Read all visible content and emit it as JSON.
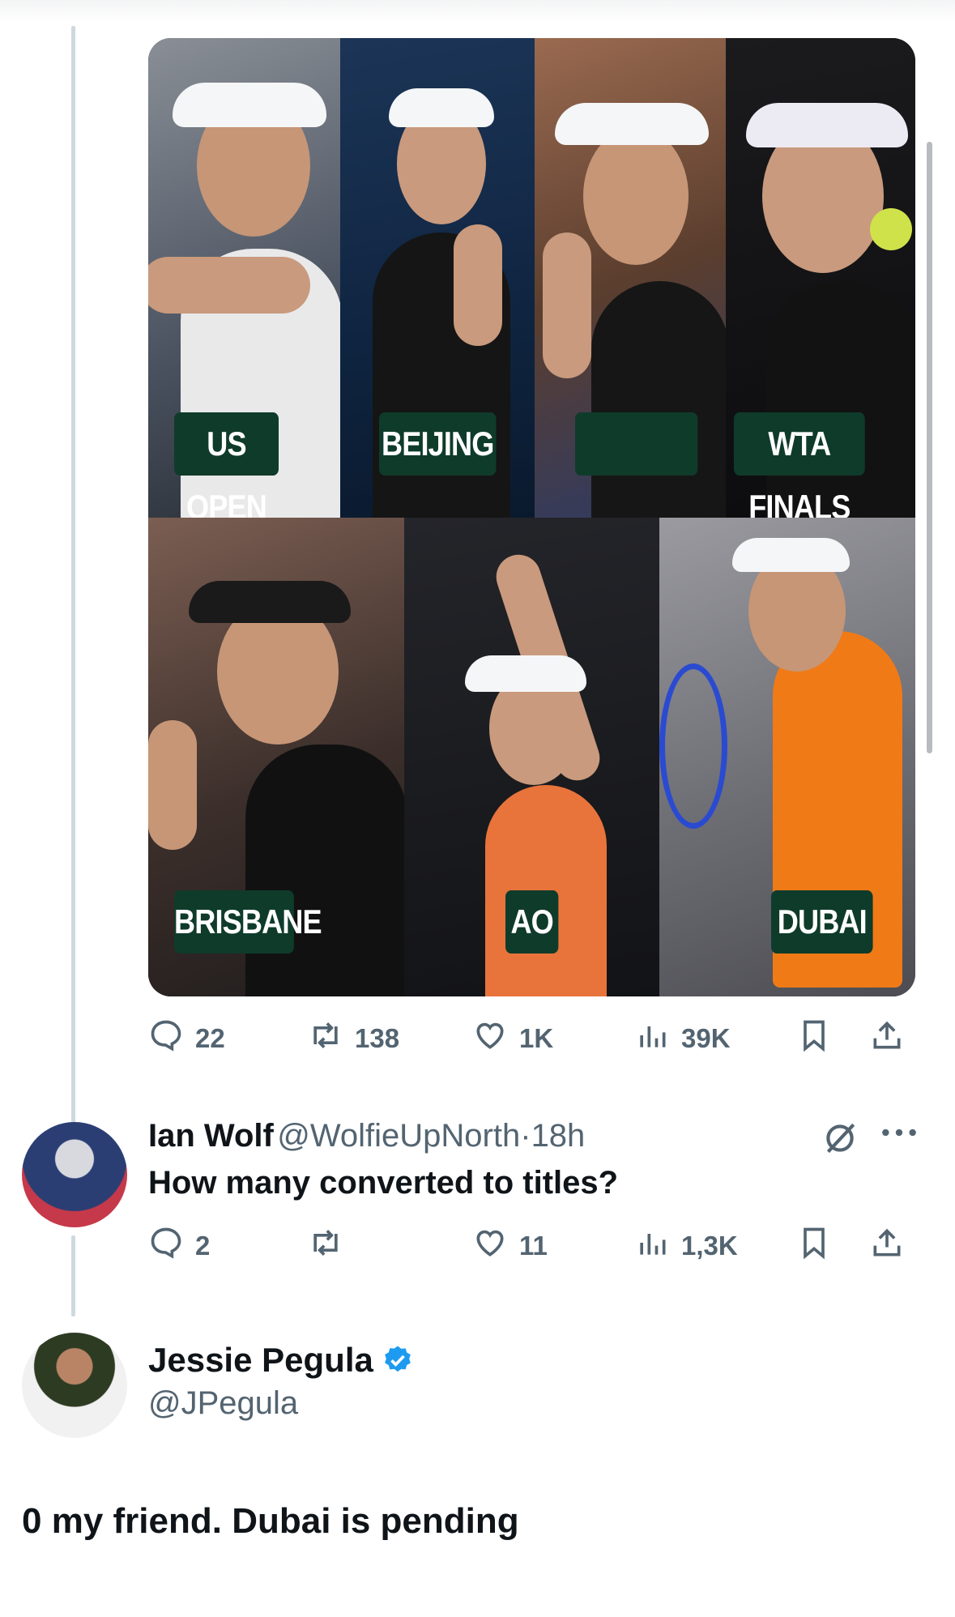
{
  "original_tweet": {
    "media_labels": {
      "us_open": "US OPEN",
      "beijing": "BEIJING",
      "blank": "",
      "wta_finals": "WTA FINALS",
      "brisbane": "BRISBANE",
      "ao": "AO",
      "dubai": "DUBAI"
    },
    "stats": {
      "replies": "22",
      "reposts": "138",
      "likes": "1K",
      "views": "39K"
    }
  },
  "reply": {
    "name": "Ian Wolf",
    "handle": "@WolfieUpNorth",
    "separator": "·",
    "time": "18h",
    "text": "How many converted to titles?",
    "stats": {
      "replies": "2",
      "reposts": "",
      "likes": "11",
      "views": "1,3K"
    }
  },
  "focused_reply": {
    "name": "Jessie Pegula",
    "handle": "@JPegula",
    "verified": true,
    "text": "0 my friend. Dubai is pending"
  },
  "icons": [
    "comment-icon",
    "repost-icon",
    "heart-icon",
    "views-icon",
    "bookmark-icon",
    "share-icon",
    "grok-icon",
    "more-icon",
    "verified-icon"
  ],
  "colors": {
    "label_bg": "#0f3b2b",
    "meta": "#536471",
    "verified": "#1d9bf0",
    "thread_line": "#cfd9de"
  }
}
